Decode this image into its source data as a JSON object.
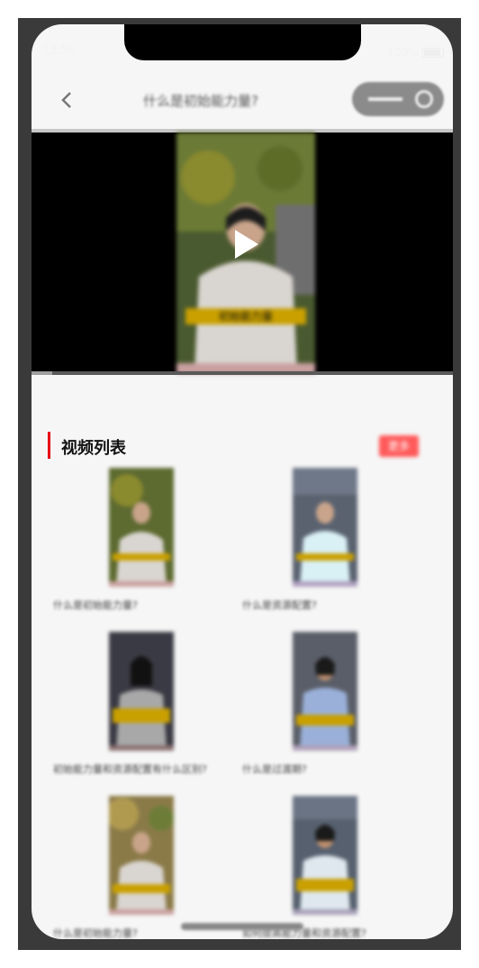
{
  "status_bar": {
    "time": "13:56",
    "battery": "100%"
  },
  "navbar": {
    "back_icon": "chevron-left-icon",
    "title": "什么是初始能力量?",
    "capsule_more_icon": "more-dots-icon",
    "capsule_close_icon": "target-circle-icon"
  },
  "player": {
    "play_icon": "play-icon",
    "progress": 0.05,
    "thumbnail_caption": "初始能力量"
  },
  "section": {
    "title": "视频列表",
    "more_label": "更多"
  },
  "videos": [
    {
      "title": "什么是初始能力量?"
    },
    {
      "title": "什么是资源配置?"
    },
    {
      "title": "初始能力量和资源配置有什么区别?"
    },
    {
      "title": "什么是过渡期?"
    },
    {
      "title": "什么是初始能力量?"
    },
    {
      "title": "如何提高能力量和资源配置?"
    }
  ],
  "colors": {
    "accent": "#e60012",
    "badge": "#ff5a5a",
    "background": "#f6f6f6",
    "device_frame": "#3a3a3a"
  }
}
